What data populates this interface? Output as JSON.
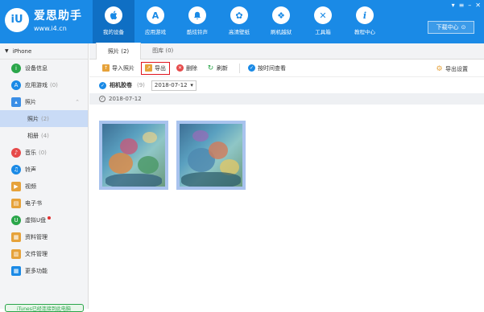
{
  "app": {
    "name": "爱思助手",
    "url": "www.i4.cn",
    "logo_text": "iU"
  },
  "nav": [
    {
      "label": "我的设备",
      "icon": "apple-icon",
      "glyph": "",
      "active": true
    },
    {
      "label": "应用游戏",
      "icon": "app-store-icon",
      "glyph": "A"
    },
    {
      "label": "酷炫铃声",
      "icon": "bell-icon",
      "glyph": "🔔"
    },
    {
      "label": "高清壁纸",
      "icon": "flower-icon",
      "glyph": "✿"
    },
    {
      "label": "刷机越狱",
      "icon": "dropbox-icon",
      "glyph": "❖"
    },
    {
      "label": "工具箱",
      "icon": "tools-icon",
      "glyph": "✕"
    },
    {
      "label": "教程中心",
      "icon": "info-icon",
      "glyph": "i"
    }
  ],
  "download_label": "下载中心",
  "sidebar": {
    "device": "iPhone",
    "items": [
      {
        "label": "设备信息",
        "count": "",
        "icon": "info-icon",
        "color": "#2aa64a"
      },
      {
        "label": "应用游戏",
        "count": "(0)",
        "icon": "app-store-icon",
        "color": "#1a8ae6"
      },
      {
        "label": "照片",
        "count": "",
        "icon": "photo-icon",
        "color": "#3a8ee6"
      },
      {
        "label": "音乐",
        "count": "(0)",
        "icon": "music-icon",
        "color": "#e64a4a"
      },
      {
        "label": "铃声",
        "count": "",
        "icon": "bell-icon",
        "color": "#1a8ae6"
      },
      {
        "label": "视频",
        "count": "",
        "icon": "video-icon",
        "color": "#e6a23a"
      },
      {
        "label": "电子书",
        "count": "",
        "icon": "book-icon",
        "color": "#e6a23a"
      },
      {
        "label": "虚拟U盘",
        "count": "",
        "icon": "usb-icon",
        "color": "#2aa64a"
      },
      {
        "label": "资料管理",
        "count": "",
        "icon": "document-icon",
        "color": "#e6a23a"
      },
      {
        "label": "文件管理",
        "count": "",
        "icon": "file-icon",
        "color": "#e6a23a"
      },
      {
        "label": "更多功能",
        "count": "",
        "icon": "grid-icon",
        "color": "#1a8ae6"
      }
    ],
    "sub_items": [
      {
        "label": "照片",
        "count": "(2)"
      },
      {
        "label": "相册",
        "count": "(4)"
      }
    ],
    "bottom_text": "iTunes已经连接到此电脑"
  },
  "tabs": [
    {
      "label": "照片 (2)"
    },
    {
      "label": "图库 (0)"
    }
  ],
  "toolbar": {
    "import": "导入照片",
    "export": "导出",
    "delete": "删除",
    "refresh": "刷新",
    "by_time": "按时间查看",
    "export_settings": "导出设置"
  },
  "filter": {
    "album": "相机胶卷",
    "count": "(9)",
    "date": "2018-07-12"
  },
  "group": {
    "date": "2018-07-12"
  },
  "colors": {
    "topbar": "#1a8ae6",
    "highlight": "#e0141e",
    "selection": "#a9c3ee"
  }
}
